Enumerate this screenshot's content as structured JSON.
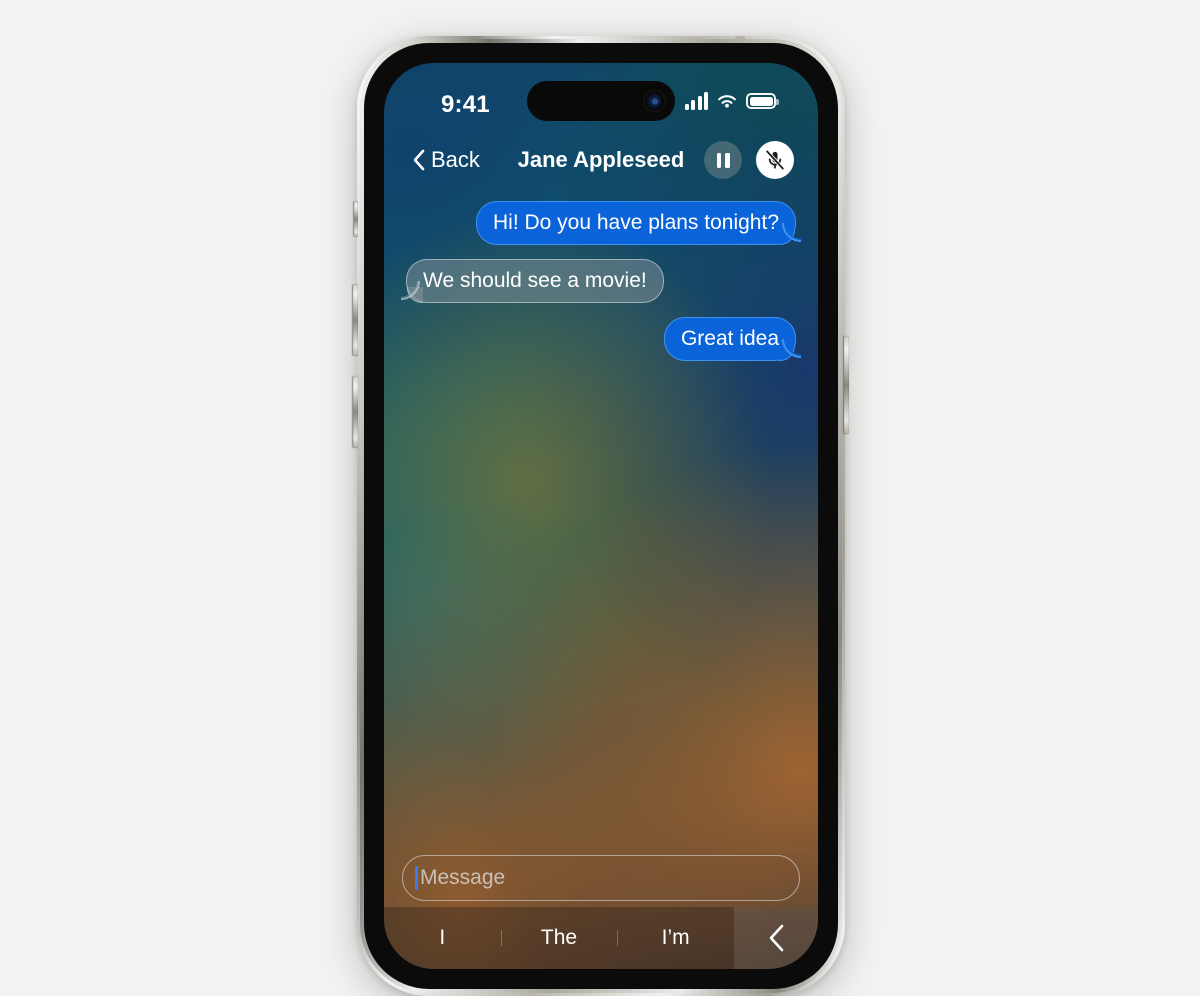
{
  "page": {
    "background_color": "#f2f2f1",
    "device": "iphone-15-pro"
  },
  "status_bar": {
    "time": "9:41",
    "cellular_icon": "signal-bars-icon",
    "cellular_bars": 4,
    "wifi_icon": "wifi-icon",
    "battery_icon": "battery-full-icon",
    "battery_level": "100"
  },
  "dynamic_island": {
    "camera_icon": "front-camera-icon"
  },
  "nav_bar": {
    "back_label": "Back",
    "back_icon": "chevron-left-icon",
    "title": "Jane Appleseed",
    "pause_button": {
      "name": "pause-button",
      "icon": "pause-icon"
    },
    "mute_button": {
      "name": "mute-button",
      "icon": "microphone-slash-icon"
    }
  },
  "conversation": {
    "messages": [
      {
        "text": "Hi! Do you have plans tonight?",
        "direction": "out"
      },
      {
        "text": "We should see a movie!",
        "direction": "in"
      },
      {
        "text": "Great idea",
        "direction": "out"
      }
    ]
  },
  "input_bar": {
    "placeholder": "Message",
    "value": "",
    "caret_color": "#3b7bf0"
  },
  "keyboard_suggestions": {
    "items": [
      {
        "label": "I"
      },
      {
        "label": "The"
      },
      {
        "label": "I’m"
      }
    ],
    "back_icon": "chevron-left-icon"
  },
  "colors": {
    "bubble_out": "#0a63d8",
    "bubble_out_border": "#3d93ef",
    "accent": "#3b7bf0",
    "page_bg": "#f2f2f1"
  }
}
